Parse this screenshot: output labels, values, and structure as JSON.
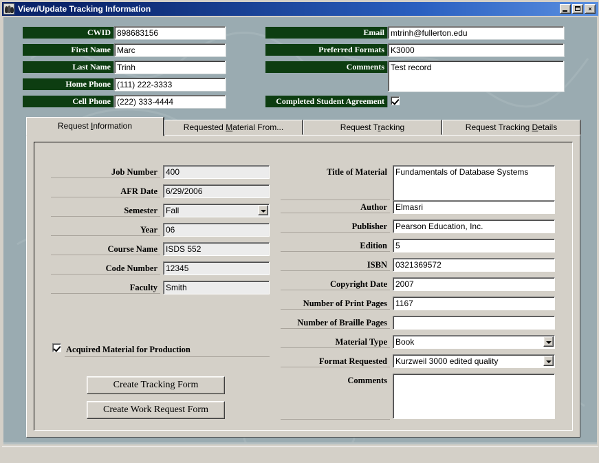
{
  "window": {
    "title": "View/Update Tracking Information",
    "icon": "people-group-icon",
    "controls": {
      "minimize": "minimize-button",
      "maximize": "maximize-button",
      "close": "×"
    }
  },
  "header": {
    "fields_left": [
      {
        "label": "CWID",
        "value": "898683156"
      },
      {
        "label": "First Name",
        "value": "Marc"
      },
      {
        "label": "Last Name",
        "value": "Trinh"
      },
      {
        "label": "Home Phone",
        "value": "(111) 222-3333"
      },
      {
        "label": "Cell Phone",
        "value": "(222) 333-4444"
      }
    ],
    "fields_right": [
      {
        "label": "Email",
        "value": "mtrinh@fullerton.edu"
      },
      {
        "label": "Preferred Formats",
        "value": "K3000"
      },
      {
        "label": "Comments",
        "value": "Test record"
      }
    ],
    "agreement": {
      "label": "Completed Student Agreement",
      "checked": true
    }
  },
  "tabs": [
    {
      "label_pre": "Request ",
      "accesskey": "I",
      "label_post": "nformation",
      "active": true
    },
    {
      "label_pre": "Requested ",
      "accesskey": "M",
      "label_post": "aterial From...",
      "active": false
    },
    {
      "label_pre": "Request T",
      "accesskey": "r",
      "label_post": "acking",
      "active": false
    },
    {
      "label_pre": "Request Tracking ",
      "accesskey": "D",
      "label_post": "etails",
      "active": false
    }
  ],
  "request_information": {
    "left_fields": [
      {
        "label": "Job Number",
        "value": "400",
        "type": "text"
      },
      {
        "label": "AFR Date",
        "value": "6/29/2006",
        "type": "text"
      },
      {
        "label": "Semester",
        "value": "Fall",
        "type": "combo"
      },
      {
        "label": "Year",
        "value": "06",
        "type": "text"
      },
      {
        "label": "Course Name",
        "value": "ISDS 552",
        "type": "text"
      },
      {
        "label": "Code Number",
        "value": "12345",
        "type": "text"
      },
      {
        "label": "Faculty",
        "value": "Smith",
        "type": "text"
      }
    ],
    "acquired_checkbox": {
      "label": "Acquired Material for Production",
      "checked": true
    },
    "buttons": [
      {
        "label": "Create Tracking Form"
      },
      {
        "label": "Create Work Request Form"
      }
    ],
    "right_fields": [
      {
        "label": "Title of Material",
        "value": "Fundamentals of Database Systems",
        "type": "textarea"
      },
      {
        "label": "Author",
        "value": "Elmasri",
        "type": "text"
      },
      {
        "label": "Publisher",
        "value": "Pearson Education, Inc.",
        "type": "text"
      },
      {
        "label": "Edition",
        "value": "5",
        "type": "text"
      },
      {
        "label": "ISBN",
        "value": "0321369572",
        "type": "text"
      },
      {
        "label": "Copyright Date",
        "value": "2007",
        "type": "text"
      },
      {
        "label": "Number of Print Pages",
        "value": "1167",
        "type": "text"
      },
      {
        "label": "Number of Braille Pages",
        "value": "",
        "type": "text"
      },
      {
        "label": "Material Type",
        "value": "Book",
        "type": "combo"
      },
      {
        "label": "Format Requested",
        "value": "Kurzweil 3000 edited quality",
        "type": "combo"
      },
      {
        "label": "Comments",
        "value": "",
        "type": "textarea"
      }
    ]
  },
  "colors": {
    "titlebar": "#0a246a",
    "label_green": "#0d3d11",
    "form_background": "#9aabb1",
    "control_face": "#d4d0c8"
  }
}
